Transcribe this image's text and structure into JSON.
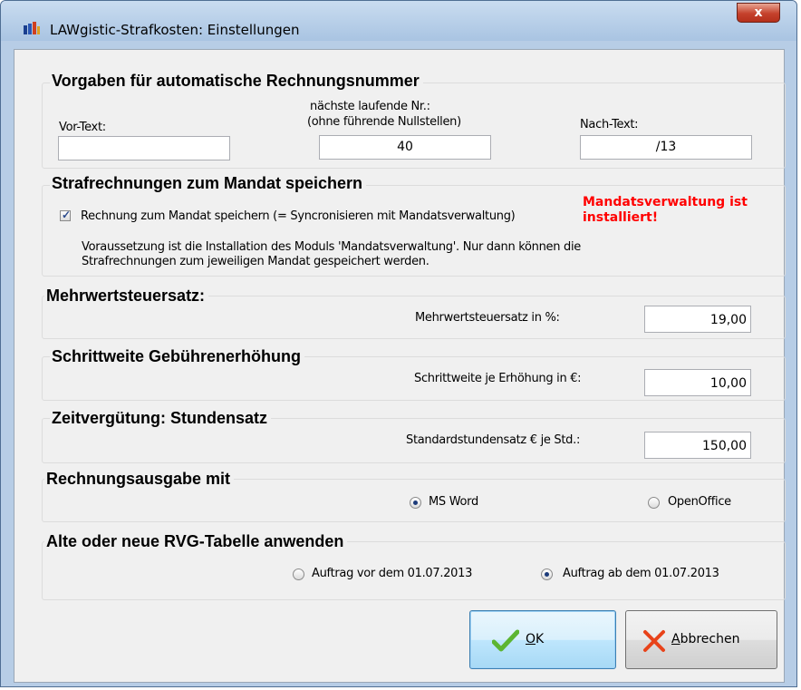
{
  "window": {
    "title": "LAWgistic-Strafkosten: Einstellungen",
    "close_label": "x"
  },
  "groups": {
    "rechnungsnummer": {
      "title": "Vorgaben für automatische Rechnungsnummer",
      "vortext_label": "Vor-Text:",
      "vortext_value": "",
      "nr_label_line1": "nächste laufende Nr.:",
      "nr_label_line2": "(ohne führende Nullstellen)",
      "nr_value": "40",
      "nachtext_label": "Nach-Text:",
      "nachtext_value": "/13"
    },
    "mandat": {
      "title": "Strafrechnungen zum Mandat speichern",
      "checkbox_label": "Rechnung zum Mandat speichern (= Syncronisieren mit Mandatsverwaltung)",
      "checkbox_checked": true,
      "warning_line1": "Mandatsverwaltung ist",
      "warning_line2": "installiert!",
      "info_line1": "Voraussetzung ist die Installation des Moduls 'Mandatsverwaltung'. Nur dann können die",
      "info_line2": "Strafrechnungen zum jeweiligen Mandat gespeichert werden."
    },
    "mwst": {
      "title": "Mehrwertsteuersatz:",
      "label": "Mehrwertsteuersatz in %:",
      "value": "19,00"
    },
    "schrittweite": {
      "title": "Schrittweite Gebührenerhöhung",
      "label": "Schrittweite je Erhöhung in €:",
      "value": "10,00"
    },
    "zeitverguetung": {
      "title": "Zeitvergütung: Stundensatz",
      "label": "Standardstundensatz € je Std.:",
      "value": "150,00"
    },
    "ausgabe": {
      "title": "Rechnungsausgabe mit",
      "option_word": "MS Word",
      "option_openoffice": "OpenOffice",
      "selected": "MS Word"
    },
    "rvg": {
      "title": "Alte oder neue RVG-Tabelle anwenden",
      "option_old": "Auftrag vor dem 01.07.2013",
      "option_new": "Auftrag ab dem 01.07.2013",
      "selected": "Auftrag ab dem 01.07.2013"
    }
  },
  "buttons": {
    "ok_mnemonic": "O",
    "ok_rest": "K",
    "cancel_mnemonic": "A",
    "cancel_rest": "bbrechen"
  },
  "colors": {
    "warning": "#ff0000",
    "ok_check": "#5cb531",
    "cancel_x": "#e8431a"
  },
  "icons": {
    "app": "app-icon",
    "ok": "checkmark-icon",
    "cancel": "x-mark-icon"
  }
}
